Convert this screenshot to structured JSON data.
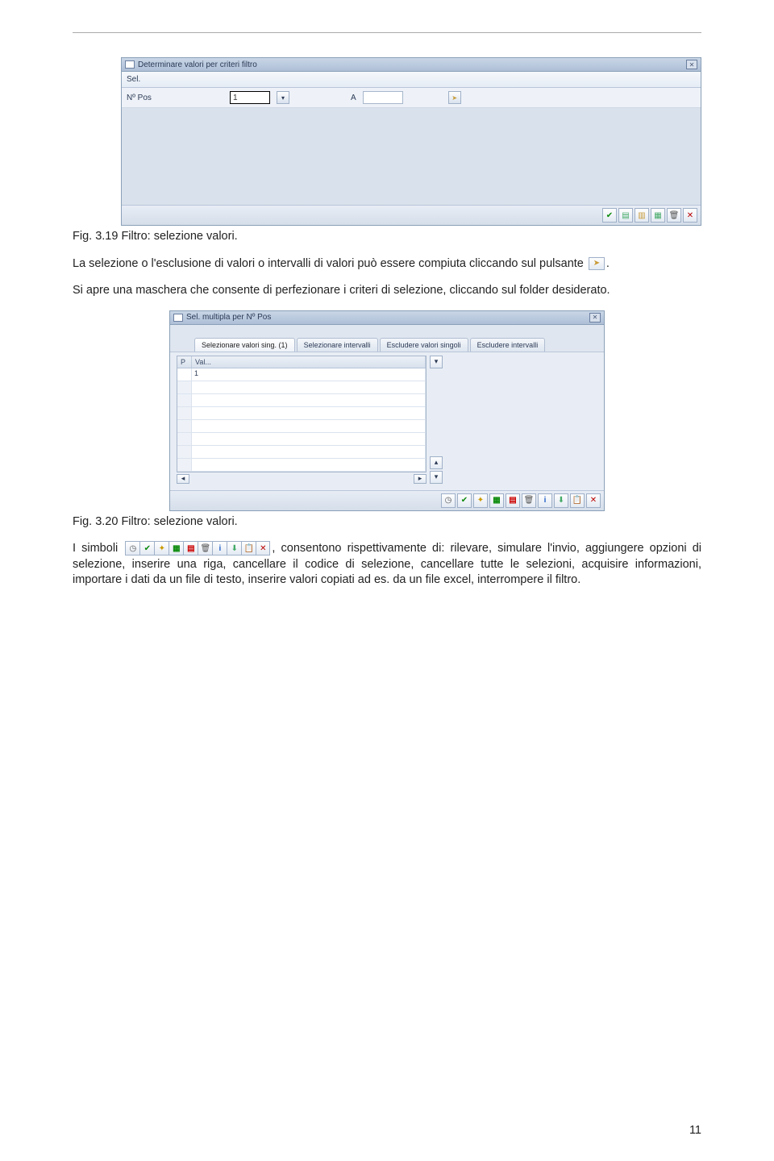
{
  "dialog1": {
    "title": "Determinare valori per criteri filtro",
    "header_label": "Sel.",
    "field_label": "Nº Pos",
    "value_from": "1",
    "label_to": "A",
    "value_to": ""
  },
  "caption1": "Fig. 3.19 Filtro: selezione valori.",
  "para1_a": "La selezione o l'esclusione di valori o intervalli di valori può essere compiuta cliccando sul pulsante ",
  "para1_b": ".",
  "para2": "Si apre una maschera che consente di perfezionare i criteri di selezione, cliccando sul folder desiderato.",
  "dialog2": {
    "title": "Sel. multipla per Nº Pos",
    "tabs": [
      "Selezionare valori sing. (1)",
      "Selezionare intervalli",
      "Escludere valori singoli",
      "Escludere intervalli"
    ],
    "col_p": "P",
    "col_val": "Val...",
    "row1": "1"
  },
  "caption2": "Fig. 3.20 Filtro: selezione valori.",
  "para3_a": "I simboli ",
  "para3_b": ", consentono rispettivamente di: rilevare, simulare l'invio, aggiungere opzioni di selezione, inserire una riga, cancellare il codice di selezione, cancellare tutte le selezioni, acquisire informazioni, importare i dati da un file di testo, inserire valori copiati ad es. da un file excel, interrompere il filtro.",
  "pagenum": "11"
}
